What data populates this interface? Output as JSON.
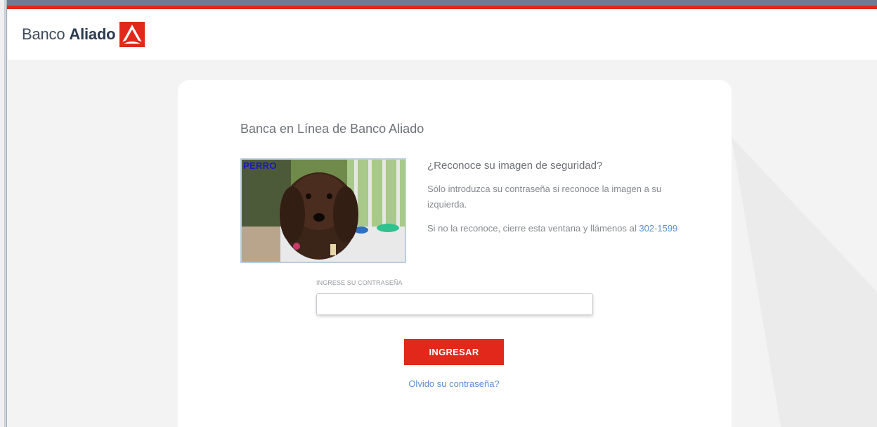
{
  "header": {
    "logo_word1": "Banco",
    "logo_word2": "Aliado"
  },
  "card": {
    "title": "Banca en Línea de Banco Aliado",
    "security_image_label": "PERRO",
    "question": "¿Reconoce su imagen de seguridad?",
    "paragraph1": "Sólo introduzca su contraseña si reconoce la imagen a su izquierda.",
    "paragraph2": "Si no la reconoce, cierre esta ventana y llámenos al",
    "phone": "302-1599",
    "password_label": "INGRESE SU CONTRASEÑA",
    "password_value": "",
    "submit_label": "INGRESAR",
    "forgot_label": "Olvido su contraseña?"
  },
  "colors": {
    "brand_red": "#e2271b",
    "link_blue": "#5b8fd1",
    "logo_navy": "#2b3a4f"
  },
  "icons": {
    "logo": "banco-aliado-triangle-logo"
  }
}
